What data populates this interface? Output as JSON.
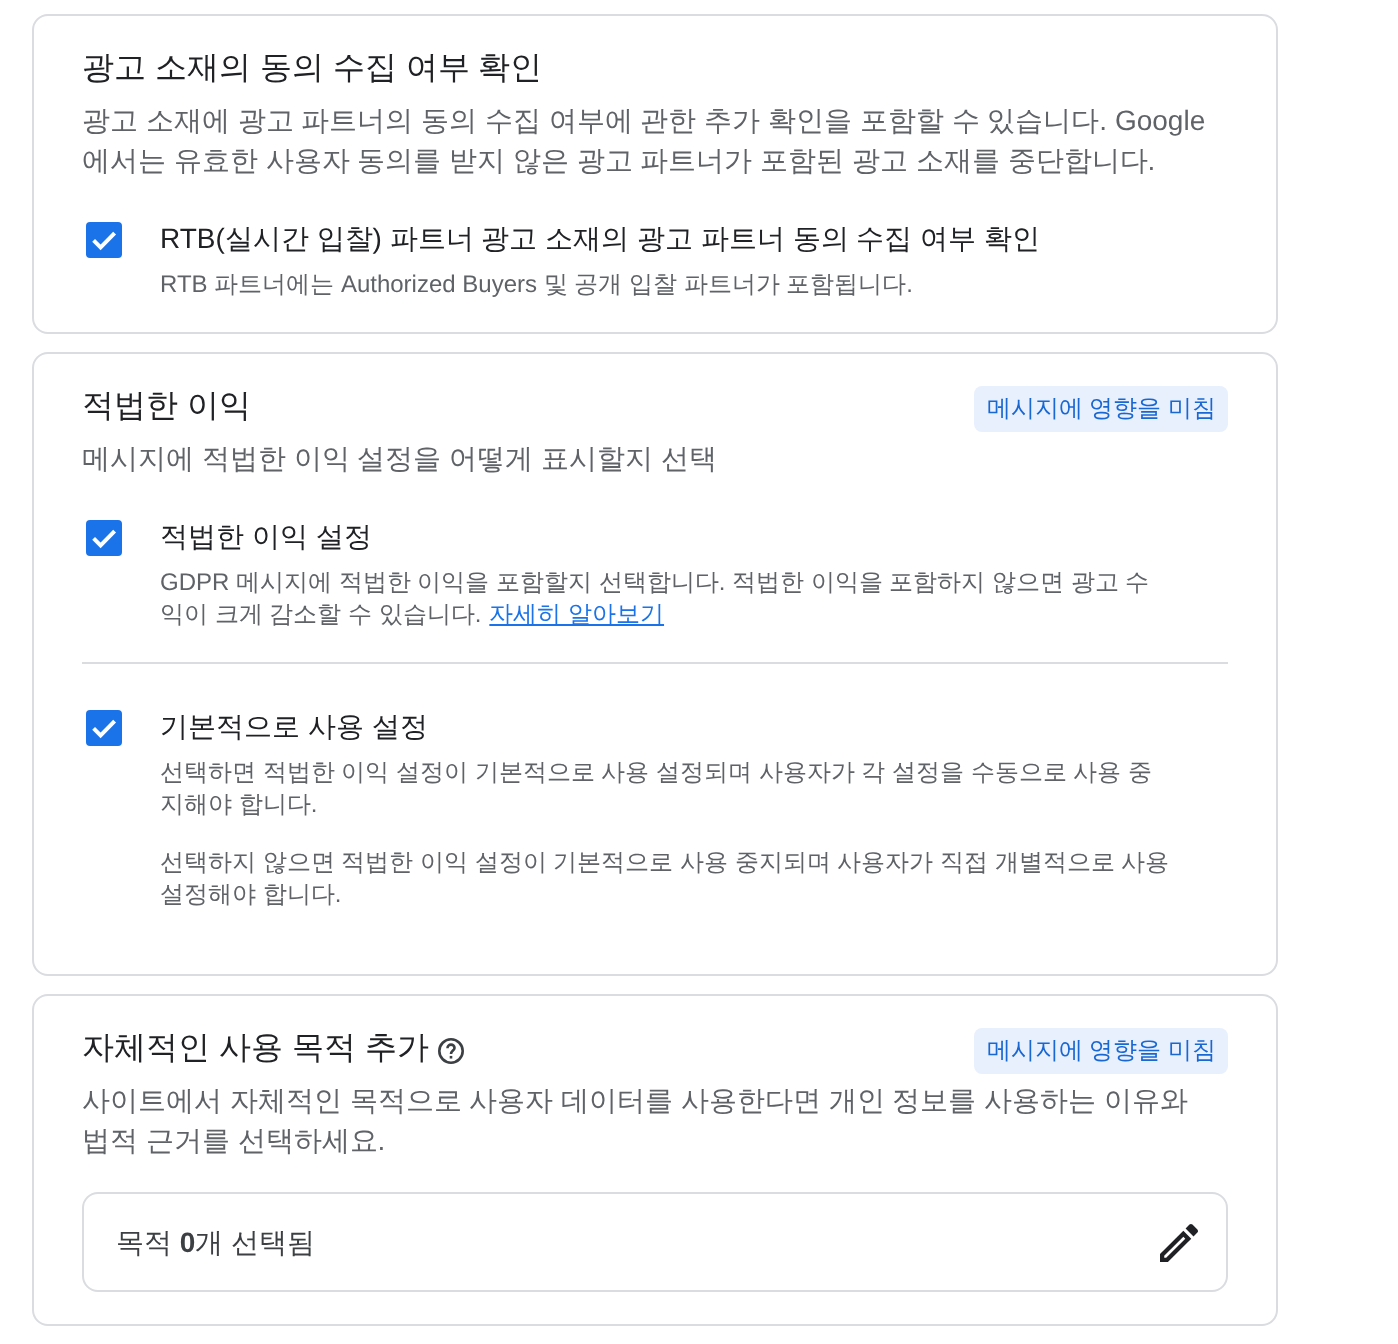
{
  "sections": [
    {
      "title": "광고 소재의 동의 수집 여부 확인",
      "description": "광고 소재에 광고 파트너의 동의 수집 여부에 관한 추가 확인을 포함할 수 있습니다. Google에서는 유효한 사용자 동의를 받지 않은 광고 파트너가 포함된 광고 소재를 중단합니다.",
      "options": [
        {
          "label": "RTB(실시간 입찰) 파트너 광고 소재의 광고 파트너 동의 수집 여부 확인",
          "checked": true,
          "help": [
            {
              "text": "RTB 파트너에는 Authorized Buyers 및 공개 입찰 파트너가 포함됩니다."
            }
          ]
        }
      ]
    },
    {
      "title": "적법한 이익",
      "badge": "메시지에 영향을 미침",
      "description": "메시지에 적법한 이익 설정을 어떻게 표시할지 선택",
      "options": [
        {
          "label": "적법한 이익 설정",
          "checked": true,
          "help": [
            {
              "text": "GDPR 메시지에 적법한 이익을 포함할지 선택합니다. 적법한 이익을 포함하지 않으면 광고 수익이 크게 감소할 수 있습니다.",
              "link": "자세히 알아보기"
            }
          ]
        },
        {
          "label": "기본적으로 사용 설정",
          "checked": true,
          "help": [
            {
              "text": "선택하면 적법한 이익 설정이 기본적으로 사용 설정되며 사용자가 각 설정을 수동으로 사용 중지해야 합니다."
            },
            {
              "text": "선택하지 않으면 적법한 이익 설정이 기본적으로 사용 중지되며 사용자가 직접 개별적으로 사용 설정해야 합니다."
            }
          ]
        }
      ]
    },
    {
      "title": "자체적인 사용 목적 추가",
      "help_icon": true,
      "badge": "메시지에 영향을 미침",
      "description": "사이트에서 자체적인 목적으로 사용자 데이터를 사용한다면 개인 정보를 사용하는 이유와 법적 근거를 선택하세요.",
      "summary": {
        "text": "목적 **0**개 선택됨"
      }
    }
  ]
}
